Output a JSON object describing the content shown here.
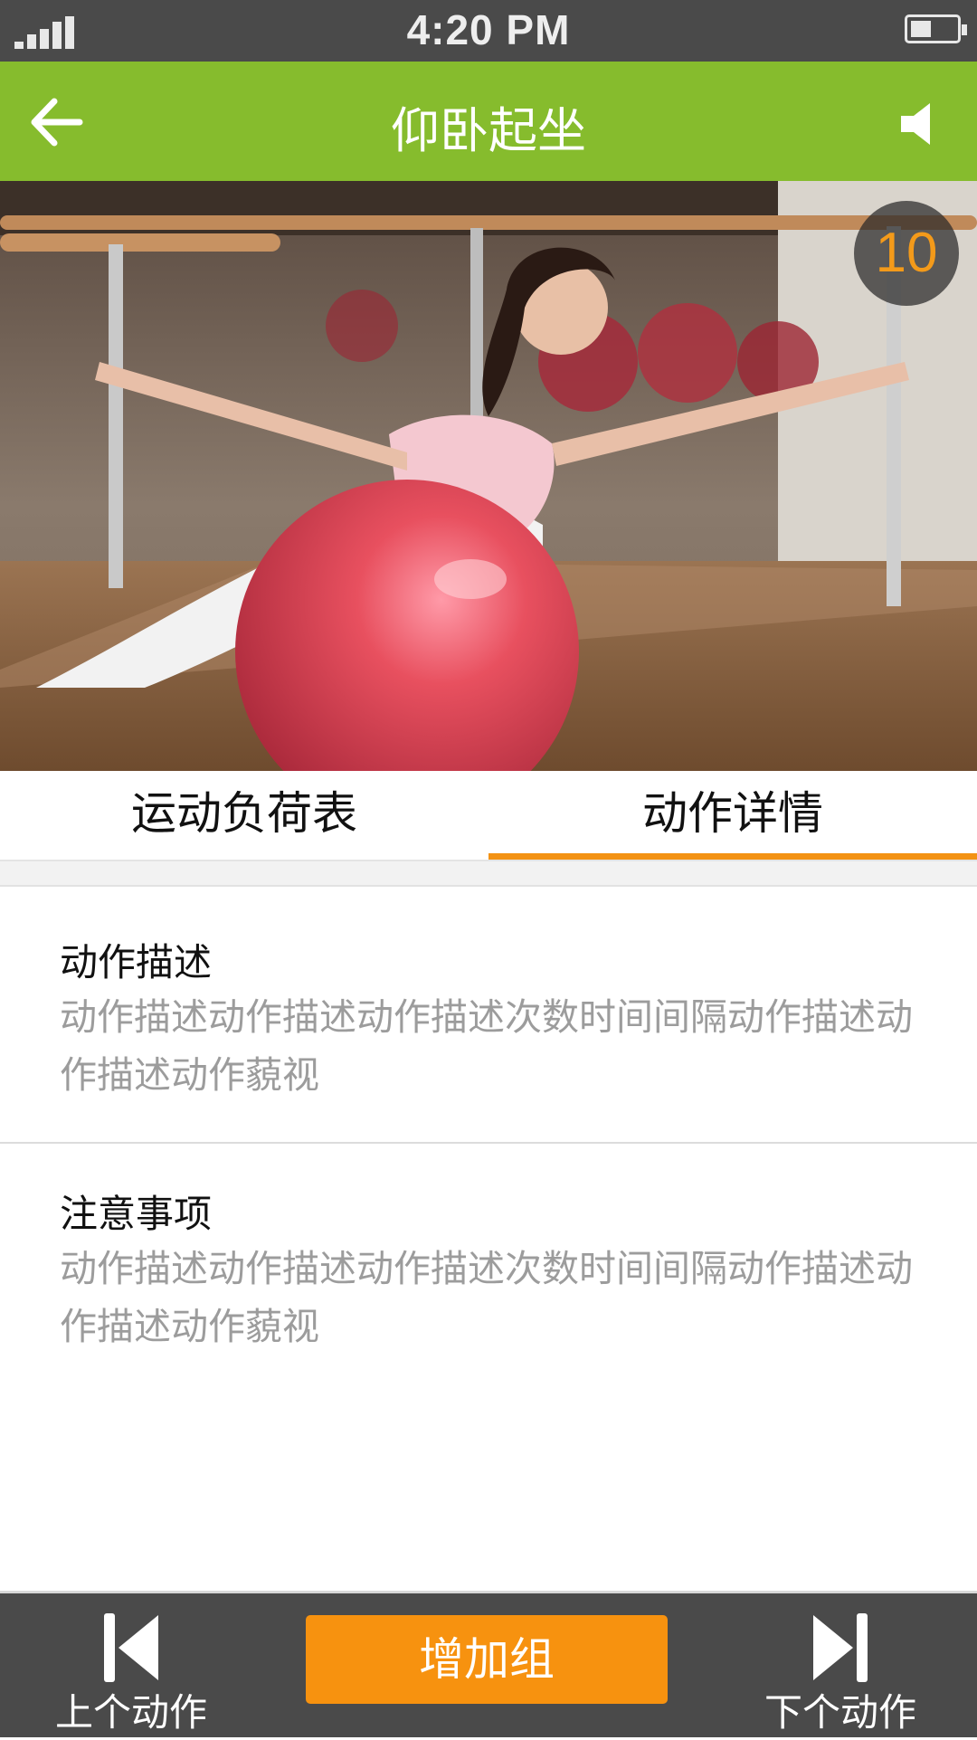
{
  "status_bar": {
    "time": "4:20 PM",
    "signal_icon": "signal-bars-icon",
    "battery_icon": "battery-icon"
  },
  "header": {
    "title": "仰卧起坐",
    "back_icon": "arrow-left-icon",
    "sound_icon": "speaker-icon",
    "background_color": "#86bc2d"
  },
  "exercise_image": {
    "description_icon": "exercise-photo",
    "counter": "10"
  },
  "tabs": [
    {
      "label": "运动负荷表",
      "active": false
    },
    {
      "label": "动作详情",
      "active": true
    }
  ],
  "sections": [
    {
      "heading": "动作描述",
      "body": "动作描述动作描述动作描述次数时间间隔动作描述动作描述动作藐视"
    },
    {
      "heading": "注意事项",
      "body": "动作描述动作描述动作描述次数时间间隔动作描述动作描述动作藐视"
    }
  ],
  "bottom_bar": {
    "prev_label": "上个动作",
    "add_label": "增加组",
    "next_label": "下个动作",
    "accent_color": "#f7920f"
  }
}
